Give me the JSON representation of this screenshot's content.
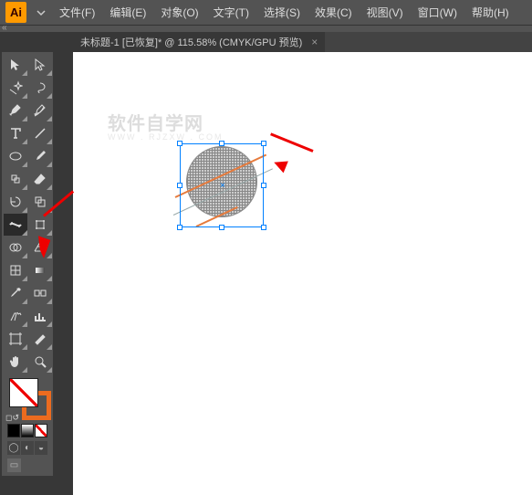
{
  "app": {
    "logo": "Ai"
  },
  "menu": {
    "file": "文件(F)",
    "edit": "编辑(E)",
    "object": "对象(O)",
    "type": "文字(T)",
    "select": "选择(S)",
    "effect": "效果(C)",
    "view": "视图(V)",
    "window": "窗口(W)",
    "help": "帮助(H)"
  },
  "doc": {
    "title": "未标题-1 [已恢复]* @ 115.58% (CMYK/GPU 预览)",
    "close": "×"
  },
  "watermark": {
    "text": "软件自学网",
    "sub": "WWW . RJZXW . COM"
  },
  "colors": {
    "accent": "#ec6b1f",
    "selection": "#0080ff",
    "arrow": "#e00"
  }
}
